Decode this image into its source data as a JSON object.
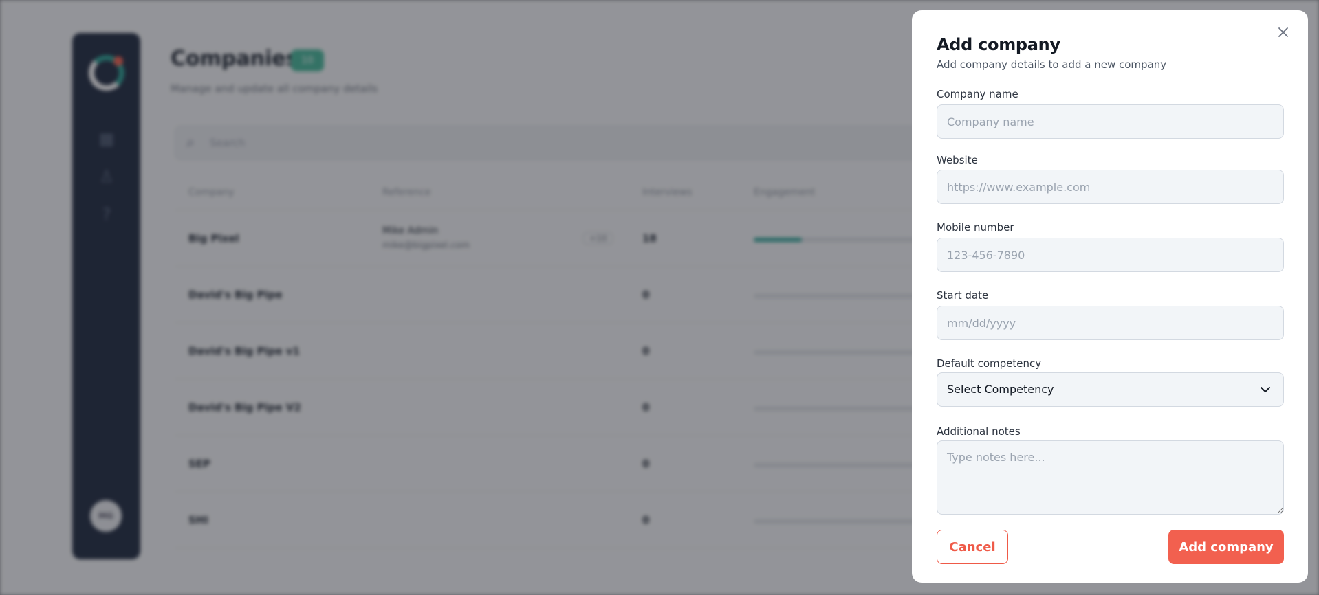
{
  "background": {
    "page_title": "Companies",
    "count_badge": "10",
    "page_subtitle": "Manage and update all company details",
    "search_placeholder": "Search",
    "columns": [
      "Company",
      "Reference",
      "Interviews",
      "Engagement"
    ],
    "rows": [
      {
        "company": "Big Pixel",
        "ref_name": "Mike Admin",
        "ref_email": "mike@bigpixel.com",
        "ref_tag": "+10",
        "interviews": "18",
        "engagement": 0.14
      },
      {
        "company": "David's Big Pipe",
        "ref_name": "",
        "ref_email": "",
        "ref_tag": "",
        "interviews": "0",
        "engagement": 0
      },
      {
        "company": "David's Big Pipe v1",
        "ref_name": "",
        "ref_email": "",
        "ref_tag": "",
        "interviews": "0",
        "engagement": 0
      },
      {
        "company": "David's Big Pipe V2",
        "ref_name": "",
        "ref_email": "",
        "ref_tag": "",
        "interviews": "0",
        "engagement": 0
      },
      {
        "company": "SEP",
        "ref_name": "",
        "ref_email": "",
        "ref_tag": "",
        "interviews": "0",
        "engagement": 0
      },
      {
        "company": "SHI",
        "ref_name": "",
        "ref_email": "",
        "ref_tag": "",
        "interviews": "0",
        "engagement": 0
      }
    ],
    "avatar_initials": "MG"
  },
  "modal": {
    "title": "Add company",
    "subtitle": "Add company details to add a new company",
    "company_name": {
      "label": "Company name",
      "placeholder": "Company name",
      "value": ""
    },
    "website": {
      "label": "Website",
      "placeholder": "https://www.example.com",
      "value": ""
    },
    "mobile": {
      "label": "Mobile number",
      "placeholder": "123-456-7890",
      "value": ""
    },
    "start_date": {
      "label": "Start date",
      "placeholder": "mm/dd/yyyy",
      "value": ""
    },
    "competency": {
      "label": "Default competency",
      "selected": "Select Competency"
    },
    "notes": {
      "label": "Additional notes",
      "placeholder": "Type notes here...",
      "value": ""
    },
    "cancel_label": "Cancel",
    "submit_label": "Add company"
  },
  "colors": {
    "accent": "#f2604f",
    "sidebar": "#1e2a40",
    "teal": "#2aa396"
  },
  "icons": {
    "close": "close-icon",
    "chevron": "chevron-down-icon",
    "search": "search-icon"
  }
}
